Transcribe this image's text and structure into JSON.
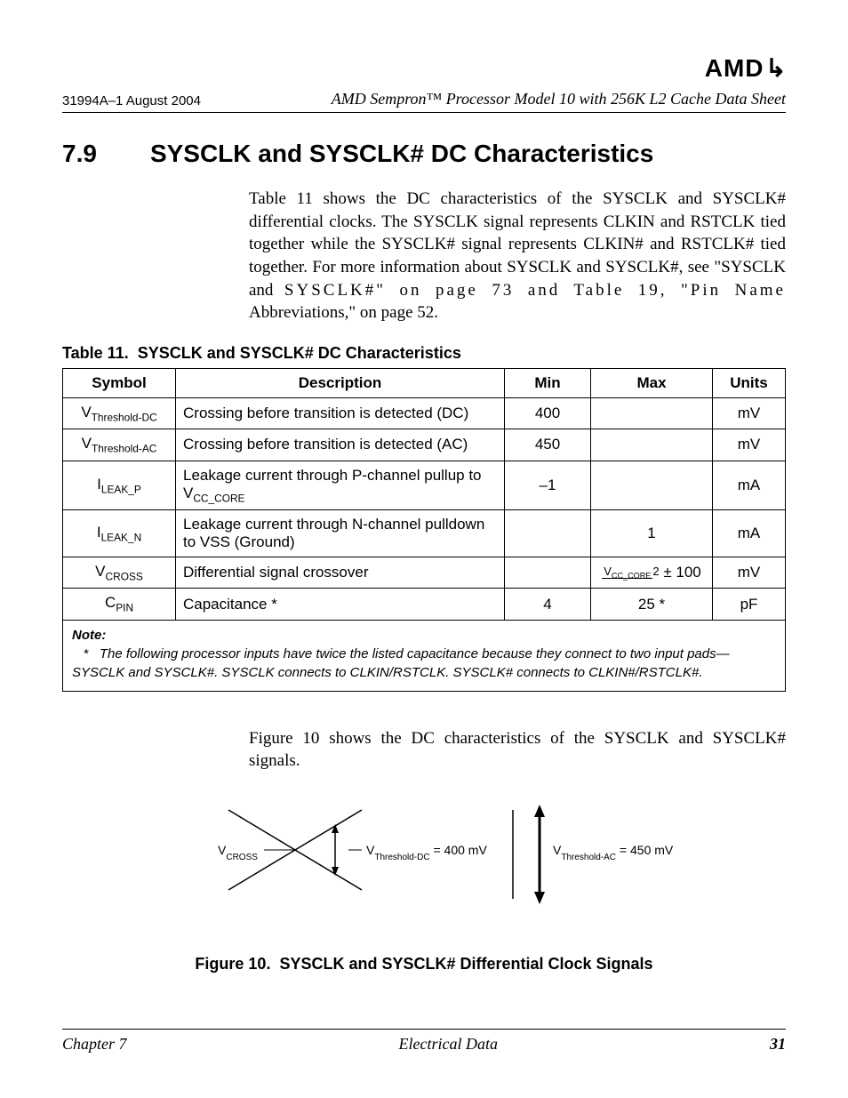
{
  "header": {
    "doc_id": "31994A–1 August 2004",
    "title": "AMD Sempron™ Processor Model 10 with 256K L2 Cache Data Sheet",
    "logo": "AMD"
  },
  "section": {
    "number": "7.9",
    "title": "SYSCLK and SYSCLK# DC Characteristics"
  },
  "para1a": "Table 11 shows the DC characteristics of the SYSCLK and SYSCLK# differential clocks. The SYSCLK signal represents CLKIN and RSTCLK tied together while the SYSCLK# signal represents CLKIN# and RSTCLK# tied together. For more information about SYSCLK and SYSCLK#, see \"SYSCLK and ",
  "para1b": "SYSCLK#\" on page 73 and Table 19, \"Pin Name ",
  "para1c": "Abbreviations,\" on page 52.",
  "table": {
    "caption_prefix": "Table 11.",
    "caption": "SYSCLK and SYSCLK# DC Characteristics",
    "headers": {
      "c1": "Symbol",
      "c2": "Description",
      "c3": "Min",
      "c4": "Max",
      "c5": "Units"
    },
    "rows": [
      {
        "sym_html": "V<sub>Threshold-DC</sub>",
        "desc": "Crossing before transition is detected (DC)",
        "min": "400",
        "max": "",
        "units": "mV"
      },
      {
        "sym_html": "V<sub>Threshold-AC</sub>",
        "desc": "Crossing before transition is detected (AC)",
        "min": "450",
        "max": "",
        "units": "mV"
      },
      {
        "sym_html": "I<sub>LEAK_P</sub>",
        "desc_html": "Leakage current through P-channel pullup to V<sub>CC_CORE</sub>",
        "min": "–1",
        "max": "",
        "units": "mA"
      },
      {
        "sym_html": "I<sub>LEAK_N</sub>",
        "desc": "Leakage current through N-channel pulldown to VSS (Ground)",
        "min": "",
        "max": "1",
        "units": "mA"
      },
      {
        "sym_html": "V<sub>CROSS</sub>",
        "desc": "Differential signal crossover",
        "min": "",
        "max_html": "<span class='frac'><span class='top'>V<sub>CC_CORE</sub></span><span class='bot'>2</span></span> ± 100",
        "units": "mV"
      },
      {
        "sym_html": "C<sub>PIN</sub>",
        "desc": "Capacitance *",
        "min": "4",
        "max": "25 *",
        "units": "pF"
      }
    ],
    "note_title": "Note:",
    "note_marker": "*",
    "note_text": "The following processor inputs have twice the listed capacitance because they connect to two input pads—SYSCLK and SYSCLK#. SYSCLK connects to CLKIN/RSTCLK. SYSCLK# connects to CLKIN#/RSTCLK#."
  },
  "para2": "Figure 10 shows the DC characteristics of the SYSCLK and SYSCLK# signals.",
  "figure": {
    "label_vcross": "V",
    "label_vcross_sub": "CROSS",
    "label_dc": "V",
    "label_dc_sub": "Threshold-DC",
    "label_dc_val": " = 400 mV",
    "label_ac": "V",
    "label_ac_sub": "Threshold-AC",
    "label_ac_val": " = 450 mV",
    "caption_prefix": "Figure 10.",
    "caption": "SYSCLK and SYSCLK# Differential Clock Signals"
  },
  "footer": {
    "left": "Chapter 7",
    "center": "Electrical Data",
    "right": "31"
  }
}
